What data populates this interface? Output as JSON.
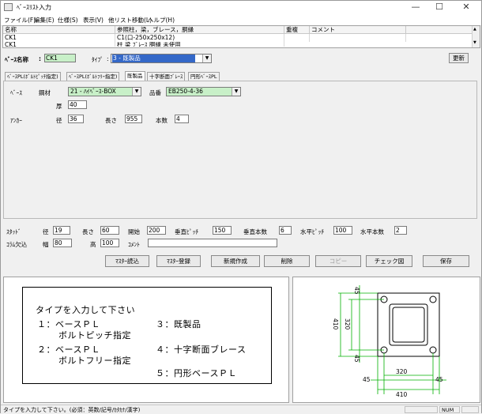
{
  "window": {
    "title": "ﾍﾞｰｽﾘｽﾄ入力",
    "min": "—",
    "max": "☐",
    "close": "✕"
  },
  "menu": [
    "ファイル(F)",
    "編集(E)",
    "仕様(S)",
    "表示(V)",
    "他リスト移動(L)",
    "ヘルプ(H)"
  ],
  "list": {
    "headers": [
      "名称",
      "参照柱，梁，ブレース，胴縁",
      "重複",
      "コメント"
    ],
    "rows": [
      [
        "CK1",
        "C1(口-250x250x12)",
        "",
        ""
      ],
      [
        "CK1",
        "柱 梁 ﾌﾞﾚｰｽ 胴縁 未使用",
        "",
        ""
      ]
    ]
  },
  "form": {
    "base_name_label": "ﾍﾞｰｽ名称",
    "base_name_value": "CK1",
    "type_label": "ﾀｲﾌﾟ",
    "type_value": "3 - 既製品",
    "update_button": "更新"
  },
  "tabs": [
    "ﾍﾞｰｽPL(ﾎﾞﾙﾄﾋﾟｯﾁ指定)",
    "ﾍﾞｰｽPL(ﾎﾞﾙﾄﾌﾘｰ指定)",
    "既製品",
    "十字断面ﾌﾞﾚｰｽ",
    "円形ﾍﾞｰｽPL"
  ],
  "base": {
    "section_label": "ﾍﾞｰｽ",
    "steel_label": "鋼材",
    "steel_value": "21 - ﾊｲﾍﾞｰｽ-BOX",
    "product_label": "品番",
    "product_value": "EB250-4-36",
    "thickness_label": "厚",
    "thickness_value": "40"
  },
  "anchor": {
    "section_label": "ｱﾝｶｰ",
    "dia_label": "径",
    "dia_value": "36",
    "length_label": "長さ",
    "length_value": "955",
    "count_label": "本数",
    "count_value": "4"
  },
  "stud": {
    "label": "ｽﾀｯﾄﾞ",
    "dia_label": "径",
    "dia_value": "19",
    "length_label": "長さ",
    "length_value": "60",
    "start_label": "開始",
    "start_value": "200",
    "vpitch_label": "垂直ﾋﾟｯﾁ",
    "vpitch_value": "150",
    "vcount_label": "垂直本数",
    "vcount_value": "6",
    "hpitch_label": "水平ﾋﾟｯﾁ",
    "hpitch_value": "100",
    "hcount_label": "水平本数",
    "hcount_value": "2"
  },
  "column_cut": {
    "label": "ｺﾗﾑ欠込",
    "width_label": "幅",
    "width_value": "80",
    "height_label": "高",
    "height_value": "100",
    "comment_label": "ｺﾒﾝﾄ",
    "comment_value": ""
  },
  "buttons": [
    "ﾏｽﾀｰ読込",
    "ﾏｽﾀｰ登録",
    "新規作成",
    "削除",
    "コピー",
    "チェック図",
    "保存"
  ],
  "instructions": [
    "タイプを入力して下さい",
    "１：ベースＰＬ",
    "ボルトピッチ指定",
    "２：ベースＰＬ",
    "ボルトフリー指定",
    "３：既製品",
    "４：十字断面ブレース",
    "５：円形ベースＰＬ"
  ],
  "drawing": {
    "dims": {
      "top_a": "45",
      "top_b": "45",
      "left_total": "410",
      "left_inner": "320",
      "bottom_inner": "320",
      "bottom_l": "45",
      "bottom_r": "45",
      "bottom_total": "410"
    }
  },
  "status": {
    "message": "タイプを入力して下さい。(必須：英数/記号/ｶﾀｶﾅ/漢字)",
    "num": "NUM"
  }
}
